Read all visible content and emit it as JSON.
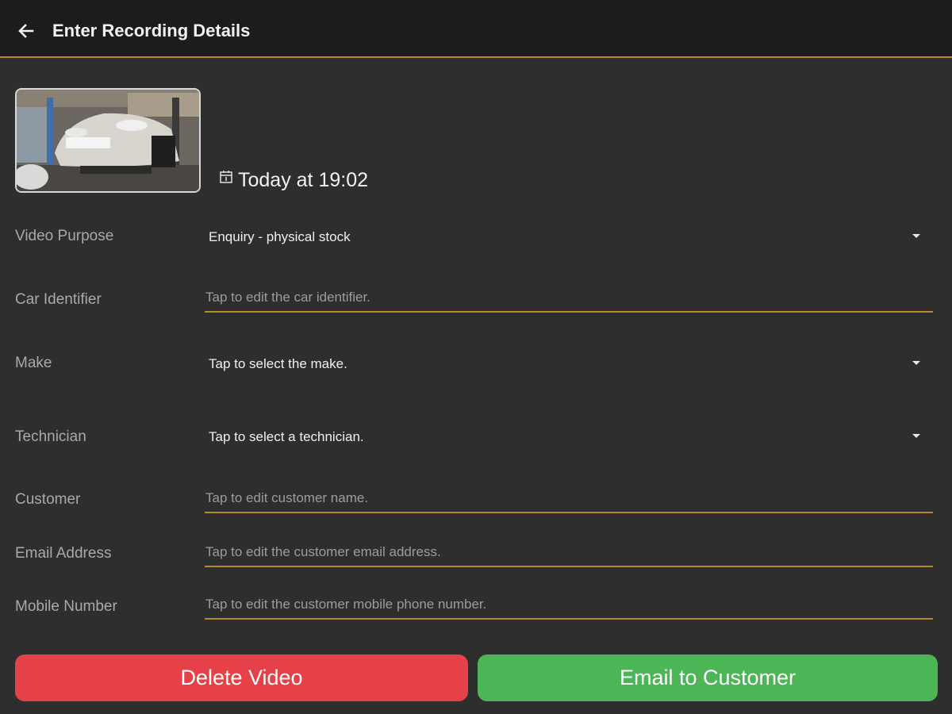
{
  "appbar": {
    "title": "Enter Recording Details"
  },
  "recording": {
    "timestamp": "Today at 19:02"
  },
  "fields": {
    "video_purpose": {
      "label": "Video Purpose",
      "value": "Enquiry - physical stock"
    },
    "car_identifier": {
      "label": "Car Identifier",
      "placeholder": "Tap to edit the car identifier."
    },
    "make": {
      "label": "Make",
      "value": "Tap to select the make."
    },
    "technician": {
      "label": "Technician",
      "value": "Tap to select a technician."
    },
    "customer": {
      "label": "Customer",
      "placeholder": "Tap to edit customer name."
    },
    "email": {
      "label": "Email Address",
      "placeholder": "Tap to edit the customer email address."
    },
    "mobile": {
      "label": "Mobile Number",
      "placeholder": "Tap to edit the customer mobile phone number."
    }
  },
  "actions": {
    "delete_label": "Delete Video",
    "email_label": "Email to Customer"
  },
  "icons": {
    "back": "arrow-back-icon",
    "calendar": "calendar-icon",
    "dropdown": "dropdown-arrow-icon"
  },
  "colors": {
    "accent": "#b48a2a",
    "delete": "#e64049",
    "email": "#4cb556",
    "appbar": "#1c1c1c",
    "background": "#2e2e2e"
  }
}
